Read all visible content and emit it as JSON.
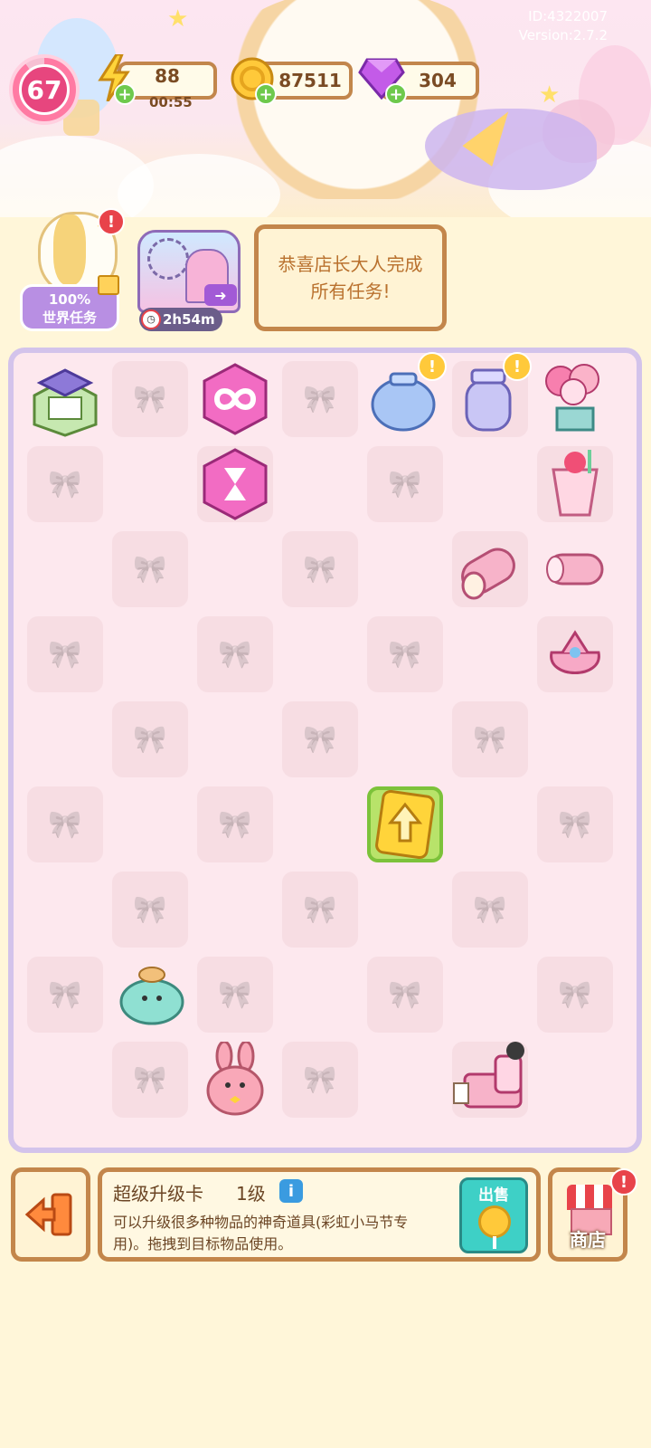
{
  "meta": {
    "id_text": "ID:4322007",
    "version_text": "Version:2.7.2"
  },
  "hud": {
    "level": "67",
    "energy": "88",
    "energy_timer": "00:55",
    "coins": "87511",
    "gems": "304"
  },
  "world_task": {
    "percent": "100%",
    "label": "世界任务"
  },
  "event": {
    "timer": "2h54m"
  },
  "notice": {
    "text": "恭喜店长大人完成所有任务!"
  },
  "board": {
    "columns": 7,
    "rows": 9
  },
  "board_items": [
    {
      "name": "house-icon",
      "row": 0,
      "col": 0
    },
    {
      "name": "infinity-hexagon-icon",
      "row": 0,
      "col": 2
    },
    {
      "name": "blue-jar-icon",
      "row": 0,
      "col": 4,
      "alert": true
    },
    {
      "name": "lavender-jar-icon",
      "row": 0,
      "col": 5,
      "alert": true
    },
    {
      "name": "balloons-gift-icon",
      "row": 0,
      "col": 6
    },
    {
      "name": "hourglass-hexagon-icon",
      "row": 1,
      "col": 2
    },
    {
      "name": "strawberry-parfait-icon",
      "row": 1,
      "col": 6
    },
    {
      "name": "pink-roll-cake-icon",
      "row": 2,
      "col": 5
    },
    {
      "name": "swiss-roll-icon",
      "row": 2,
      "col": 6
    },
    {
      "name": "candy-bag-icon",
      "row": 3,
      "col": 6
    },
    {
      "name": "upgrade-card-icon",
      "row": 5,
      "col": 4,
      "selected": true
    },
    {
      "name": "seal-plush-icon",
      "row": 7,
      "col": 1
    },
    {
      "name": "bunny-plush-icon",
      "row": 8,
      "col": 2
    },
    {
      "name": "pink-bed-icon",
      "row": 8,
      "col": 5
    }
  ],
  "selected_item": {
    "title": "超级升级卡",
    "level": "1级",
    "info_icon": "i",
    "description": "可以升级很多种物品的神奇道具(彩虹小马节专用)。拖拽到目标物品使用。"
  },
  "buttons": {
    "sell": "出售",
    "shop": "商店"
  },
  "colors": {
    "frame_brown": "#c3864b",
    "board_border": "#d3c3eb",
    "accent_pink": "#e7467e",
    "sell_teal": "#3ed0c6",
    "alert_red": "#e8434a"
  }
}
